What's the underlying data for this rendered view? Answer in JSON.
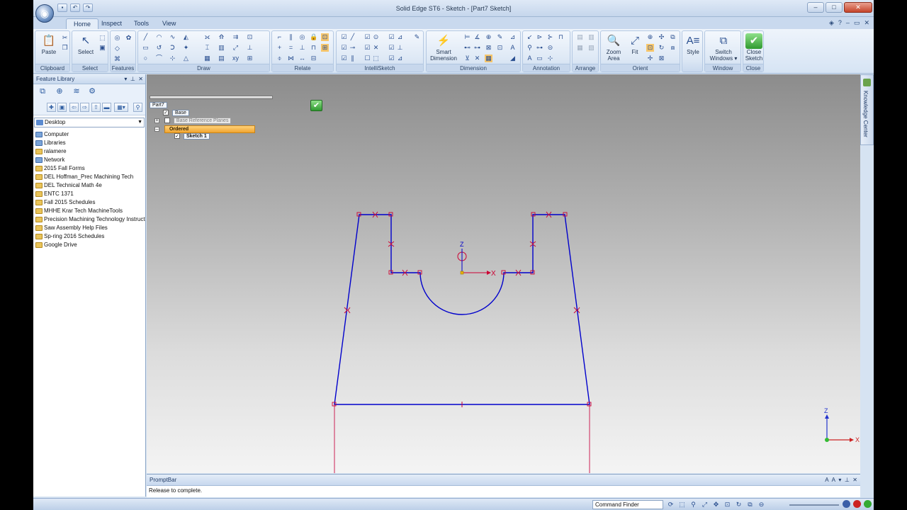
{
  "window": {
    "title": "Solid Edge ST6 - Sketch - [Part7 Sketch]",
    "controls": [
      "–",
      "□",
      "✕"
    ]
  },
  "ribbon": {
    "tabs": [
      "Home",
      "Inspect",
      "Tools",
      "View"
    ],
    "active_tab": "Home",
    "groups": {
      "clipboard": {
        "label": "Clipboard",
        "paste": "Paste"
      },
      "select": {
        "label": "Select",
        "select": "Select"
      },
      "features": {
        "label": "Features"
      },
      "draw": {
        "label": "Draw"
      },
      "relate": {
        "label": "Relate"
      },
      "intellisketch": {
        "label": "IntelliSketch"
      },
      "dimension": {
        "label": "Dimension",
        "smart": "Smart",
        "smart2": "Dimension"
      },
      "annotation": {
        "label": "Annotation"
      },
      "arrange": {
        "label": "Arrange"
      },
      "orient": {
        "label": "Orient",
        "zoom_area": "Zoom",
        "zoom_area2": "Area",
        "fit": "Fit"
      },
      "style": {
        "label": "Style"
      },
      "window": {
        "label": "Window",
        "switch": "Switch",
        "switch2": "Windows ▾"
      },
      "close": {
        "label": "Close",
        "close_sketch": "Close",
        "close_sketch2": "Sketch"
      }
    }
  },
  "feature_library": {
    "title": "Feature Library",
    "location": "Desktop",
    "items": [
      {
        "label": "Computer",
        "kind": "sys"
      },
      {
        "label": "Libraries",
        "kind": "sys"
      },
      {
        "label": "ralamere",
        "kind": "folder"
      },
      {
        "label": "Network",
        "kind": "sys"
      },
      {
        "label": "2015 Fall Forms",
        "kind": "folder"
      },
      {
        "label": "DEL Hoffman_Prec Machining Tech",
        "kind": "folder"
      },
      {
        "label": "DEL Technical Math 4e",
        "kind": "folder"
      },
      {
        "label": "ENTC 1371",
        "kind": "folder"
      },
      {
        "label": "Fall 2015 Schedules",
        "kind": "folder"
      },
      {
        "label": "MHHE Krar Tech MachineTools",
        "kind": "folder"
      },
      {
        "label": "Precision Machining Technology Instructo",
        "kind": "folder"
      },
      {
        "label": "Saw Assembly Help Files",
        "kind": "folder"
      },
      {
        "label": "Sp-ring 2016 Schedules",
        "kind": "folder"
      },
      {
        "label": "Google Drive",
        "kind": "folder"
      }
    ]
  },
  "pathfinder": {
    "part": "Part7",
    "base": "Base",
    "base_planes": "Base Reference Planes",
    "ordered": "Ordered",
    "sketch": "Sketch 1"
  },
  "triad": {
    "z": "Z",
    "x": "X"
  },
  "sketch_axes": {
    "z": "Z",
    "x": "X"
  },
  "side_panel": {
    "label": "Knowledge Center"
  },
  "prompt_bar": {
    "title": "PromptBar",
    "message": "Release to complete."
  },
  "status_bar": {
    "command_finder": "Command Finder"
  },
  "colors": {
    "sketch_line": "#0000cc",
    "relation_marker": "#cc0033",
    "accent": "#2a4f90"
  }
}
